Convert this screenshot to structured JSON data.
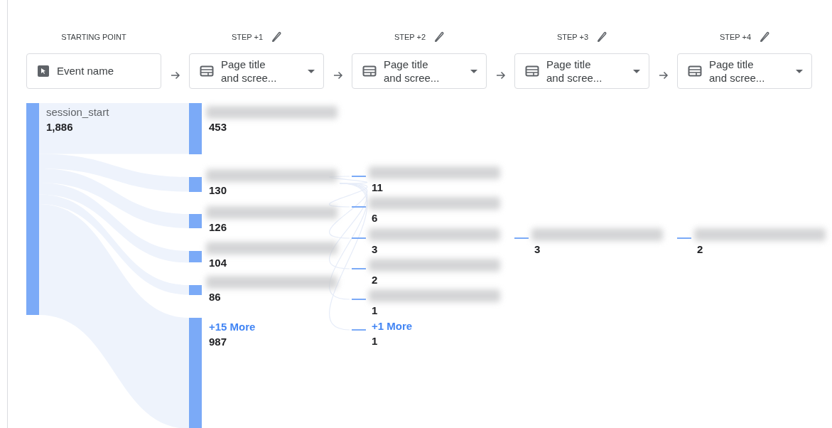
{
  "columns": [
    {
      "label": "STARTING POINT",
      "editable": false,
      "selector": {
        "text": "Event name",
        "kind": "event",
        "dropdown": false
      },
      "nodes": [
        {
          "kind": "named",
          "label": "session_start",
          "value": "1,886"
        }
      ]
    },
    {
      "label": "STEP +1",
      "editable": true,
      "selector": {
        "text": "Page title\nand scree...",
        "kind": "page",
        "dropdown": true
      },
      "nodes": [
        {
          "kind": "blurred",
          "value": "453"
        },
        {
          "kind": "blurred",
          "value": "130"
        },
        {
          "kind": "blurred",
          "value": "126"
        },
        {
          "kind": "blurred",
          "value": "104"
        },
        {
          "kind": "blurred",
          "value": "86"
        },
        {
          "kind": "more",
          "label": "+15 More",
          "value": "987"
        }
      ]
    },
    {
      "label": "STEP +2",
      "editable": true,
      "selector": {
        "text": "Page title\nand scree...",
        "kind": "page",
        "dropdown": true
      },
      "nodes": [
        {
          "kind": "blurred",
          "value": "11"
        },
        {
          "kind": "blurred",
          "value": "6"
        },
        {
          "kind": "blurred",
          "value": "3"
        },
        {
          "kind": "blurred",
          "value": "2"
        },
        {
          "kind": "blurred",
          "value": "1"
        },
        {
          "kind": "more",
          "label": "+1 More",
          "value": "1"
        }
      ]
    },
    {
      "label": "STEP +3",
      "editable": true,
      "selector": {
        "text": "Page title\nand scree...",
        "kind": "page",
        "dropdown": true
      },
      "nodes": [
        {
          "kind": "blurred",
          "value": "3"
        }
      ]
    },
    {
      "label": "STEP +4",
      "editable": true,
      "selector": {
        "text": "Page title\nand scree...",
        "kind": "page",
        "dropdown": true
      },
      "nodes": [
        {
          "kind": "blurred",
          "value": "2"
        }
      ]
    }
  ]
}
